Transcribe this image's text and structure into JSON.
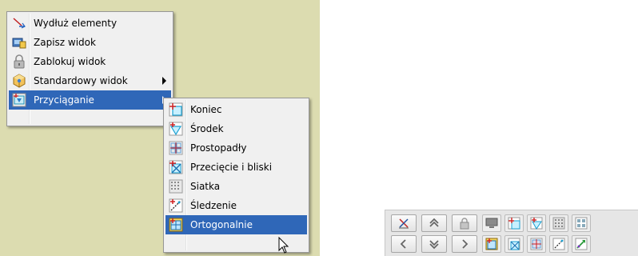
{
  "main_menu": {
    "items": [
      {
        "label": "Wydłuż elementy",
        "icon": "extend-icon"
      },
      {
        "label": "Zapisz widok",
        "icon": "save-view-icon"
      },
      {
        "label": "Zablokuj widok",
        "icon": "lock-icon"
      },
      {
        "label": "Standardowy widok",
        "icon": "standard-view-icon",
        "has_submenu": true
      },
      {
        "label": "Przyciąganie",
        "icon": "snap-icon",
        "has_submenu": true,
        "selected": true
      }
    ]
  },
  "snap_submenu": {
    "items": [
      {
        "label": "Koniec",
        "icon": "snap-end-icon"
      },
      {
        "label": "Środek",
        "icon": "snap-middle-icon"
      },
      {
        "label": "Prostopadły",
        "icon": "snap-perpendicular-icon"
      },
      {
        "label": "Przecięcie i bliski",
        "icon": "snap-intersection-icon"
      },
      {
        "label": "Siatka",
        "icon": "snap-grid-icon"
      },
      {
        "label": "Śledzenie",
        "icon": "snap-tracking-icon"
      },
      {
        "label": "Ortogonalnie",
        "icon": "snap-orthogonal-icon",
        "selected": true
      }
    ]
  },
  "toolbar": {
    "buttons": [
      "zoom-extents-icon",
      "up-double-icon",
      "lock-icon",
      "monitor-icon",
      "left-icon",
      "down-double-icon",
      "right-icon"
    ],
    "snap_buttons": [
      "snap-end-icon",
      "snap-middle-icon",
      "snap-grid-icon",
      "snap-perpendicular-icon",
      "snap-orthogonal-icon",
      "snap-intersection-icon",
      "snap-perpendicular-icon",
      "snap-tracking-icon",
      "snap-move-icon"
    ]
  },
  "colors": {
    "canvas_background": "#dcdcb0",
    "menu_background": "#f0f0f0",
    "selection": "#2f67b8"
  }
}
